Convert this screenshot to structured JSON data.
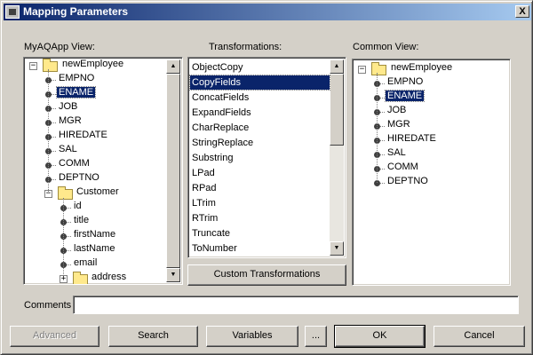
{
  "window": {
    "title": "Mapping Parameters",
    "close_glyph": "X"
  },
  "left_panel": {
    "label": "MyAQApp View:",
    "root": {
      "label": "newEmployee",
      "expander": "−"
    },
    "fields": [
      "EMPNO",
      "ENAME",
      "JOB",
      "MGR",
      "HIREDATE",
      "SAL",
      "COMM",
      "DEPTNO"
    ],
    "selected": "ENAME",
    "child": {
      "label": "Customer",
      "expander": "−"
    },
    "child_fields": [
      "id",
      "title",
      "firstName",
      "lastName",
      "email"
    ],
    "grandchild": {
      "label": "address",
      "expander": "+"
    }
  },
  "middle_panel": {
    "label": "Transformations:",
    "items": [
      "ObjectCopy",
      "CopyFields",
      "ConcatFields",
      "ExpandFields",
      "CharReplace",
      "StringReplace",
      "Substring",
      "LPad",
      "RPad",
      "LTrim",
      "RTrim",
      "Truncate",
      "ToNumber"
    ],
    "selected": "CopyFields",
    "custom_button": "Custom Transformations"
  },
  "right_panel": {
    "label": "Common View:",
    "root": {
      "label": "newEmployee",
      "expander": "−"
    },
    "fields": [
      "EMPNO",
      "ENAME",
      "JOB",
      "MGR",
      "HIREDATE",
      "SAL",
      "COMM",
      "DEPTNO"
    ],
    "selected": "ENAME"
  },
  "comments": {
    "label": "Comments",
    "value": ""
  },
  "buttons": {
    "advanced": "Advanced",
    "search": "Search",
    "variables": "Variables",
    "ellipsis": "...",
    "ok": "OK",
    "cancel": "Cancel"
  },
  "scroll_glyphs": {
    "up": "▲",
    "down": "▼"
  },
  "colors": {
    "title_start": "#0a246a",
    "title_end": "#a6caf0",
    "selection": "#0a246a",
    "face": "#d4d0c8"
  }
}
